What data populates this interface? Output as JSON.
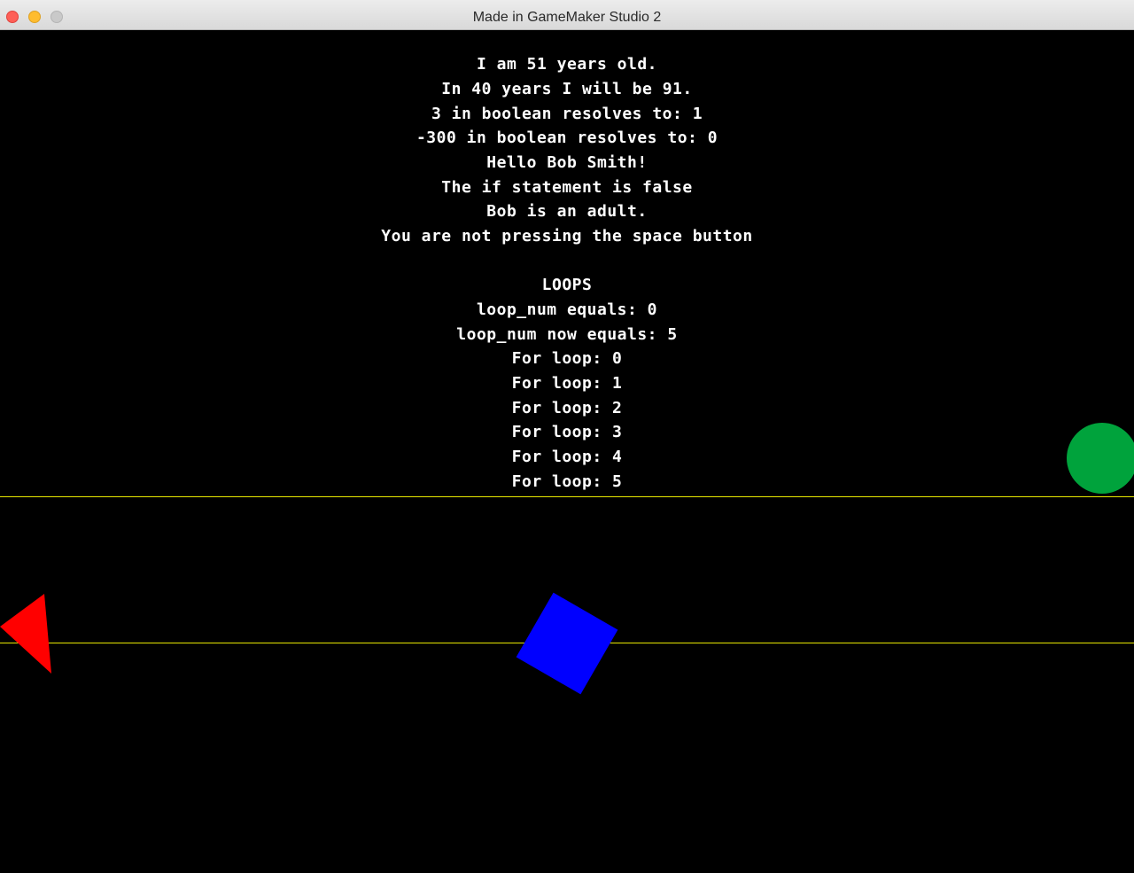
{
  "window": {
    "title": "Made in GameMaker Studio 2"
  },
  "colors": {
    "background": "#000000",
    "text": "#ffffff",
    "guide_line": "#e8e800",
    "player_circle": "#00a33c",
    "square": "#0000ff",
    "arrow": "#ff0000"
  },
  "game": {
    "output_lines": [
      "I am 51 years old.",
      "In 40 years I will be 91.",
      "3 in boolean resolves to: 1",
      "-300 in boolean resolves to: 0",
      "Hello Bob Smith!",
      "The if statement is false",
      "Bob is an adult.",
      "You are not pressing the space button",
      "",
      "LOOPS",
      "loop_num equals: 0",
      "loop_num now equals: 5",
      "For loop: 0",
      "For loop: 1",
      "For loop: 2",
      "For loop: 3",
      "For loop: 4",
      "For loop: 5"
    ]
  }
}
